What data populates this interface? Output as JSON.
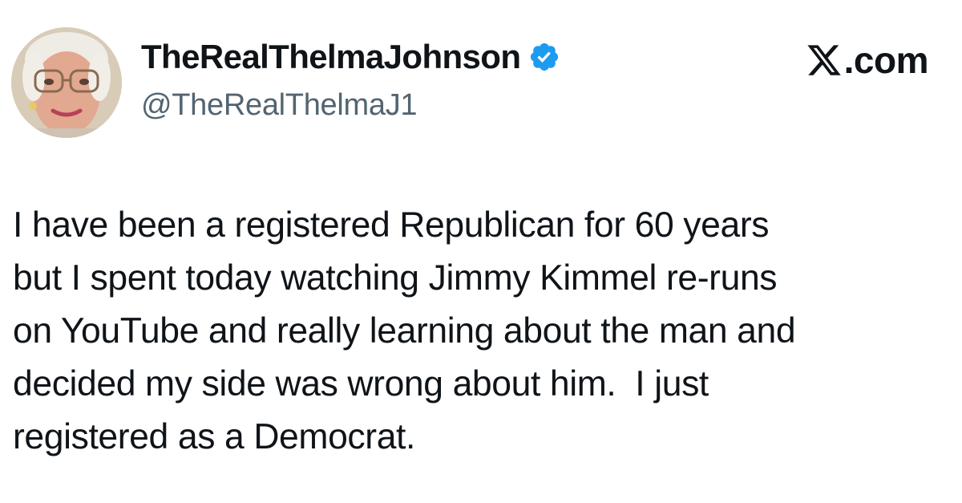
{
  "author": {
    "display_name": "TheRealThelmaJohnson",
    "handle": "@TheRealThelmaJ1",
    "avatar_icon": "profile-photo",
    "verified_icon": "verified-badge-icon",
    "verified_color": "#1d9bf0"
  },
  "brand": {
    "label": ".com",
    "logo_icon": "x-logo-icon"
  },
  "tweet": {
    "lines": [
      "I have been a registered Republican for 60 years",
      "but I spent today watching Jimmy Kimmel re-runs",
      "on YouTube and really learning about the man and",
      "decided my side was wrong about him.  I just",
      "registered as a Democrat."
    ]
  }
}
